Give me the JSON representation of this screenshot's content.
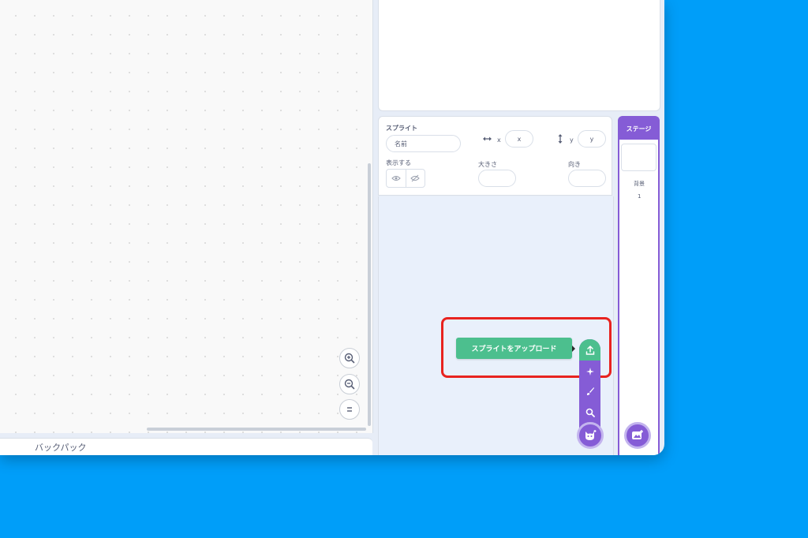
{
  "code_area": {
    "zoom_in_icon": "zoom-in-icon",
    "zoom_out_icon": "zoom-out-icon",
    "zoom_reset_icon": "zoom-reset-icon"
  },
  "backpack": {
    "label": "バックパック"
  },
  "sprite_info": {
    "sprite_label": "スプライト",
    "name_placeholder": "名前",
    "x_label": "x",
    "x_placeholder": "x",
    "y_label": "y",
    "y_placeholder": "y",
    "show_label": "表示する",
    "size_label": "大きさ",
    "direction_label": "向き"
  },
  "stage_panel": {
    "title": "ステージ",
    "backdrops_label": "背景",
    "backdrops_count": "1"
  },
  "sprite_menu": {
    "tooltip": "スプライトをアップロード",
    "items": [
      "upload-icon",
      "surprise-icon",
      "paint-icon",
      "search-icon",
      "sprite-cat-icon"
    ]
  },
  "colors": {
    "accent": "#855cd6",
    "upload_green": "#4cbf8e",
    "highlight": "#e8231f",
    "background": "#009ef9"
  }
}
